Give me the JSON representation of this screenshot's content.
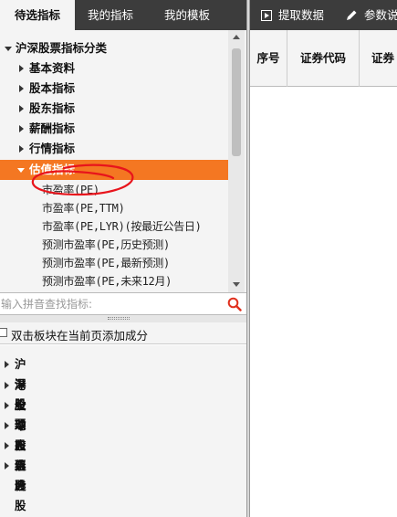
{
  "tabs": [
    {
      "label": "待选指标"
    },
    {
      "label": "我的指标"
    },
    {
      "label": "我的模板"
    }
  ],
  "tree": {
    "root_label": "沪深股票指标分类",
    "categories": [
      {
        "label": "基本资料"
      },
      {
        "label": "股本指标"
      },
      {
        "label": "股东指标"
      },
      {
        "label": "薪酬指标"
      },
      {
        "label": "行情指标"
      }
    ],
    "selected_category": {
      "label": "估值指标"
    },
    "leaves": [
      {
        "label": "市盈率(PE)"
      },
      {
        "label": "市盈率(PE,TTM)"
      },
      {
        "label": "市盈率(PE,LYR)(按最近公告日)"
      },
      {
        "label": "预测市盈率(PE,历史预测)"
      },
      {
        "label": "预测市盈率(PE,最新预测)"
      },
      {
        "label": "预测市盈率(PE,未来12月)"
      }
    ]
  },
  "search": {
    "placeholder": "输入拼音查找指标:",
    "value": ""
  },
  "checkbox": {
    "label": "双击板块在当前页添加成分",
    "checked": false
  },
  "bottom_tree": {
    "items": [
      {
        "label": "沪深股票"
      },
      {
        "label": "港股"
      },
      {
        "label": "全球股票"
      },
      {
        "label": "动态自选股"
      },
      {
        "label": "自选股"
      },
      {
        "label": "组合"
      }
    ]
  },
  "toolbar": {
    "extract_label": "提取数据",
    "params_label": "参数说"
  },
  "table": {
    "columns": [
      "序号",
      "证券代码",
      "证券"
    ]
  },
  "colors": {
    "accent": "#f47722",
    "toolbar_bg": "#3c3c3c",
    "annotation": "#e8141c"
  }
}
